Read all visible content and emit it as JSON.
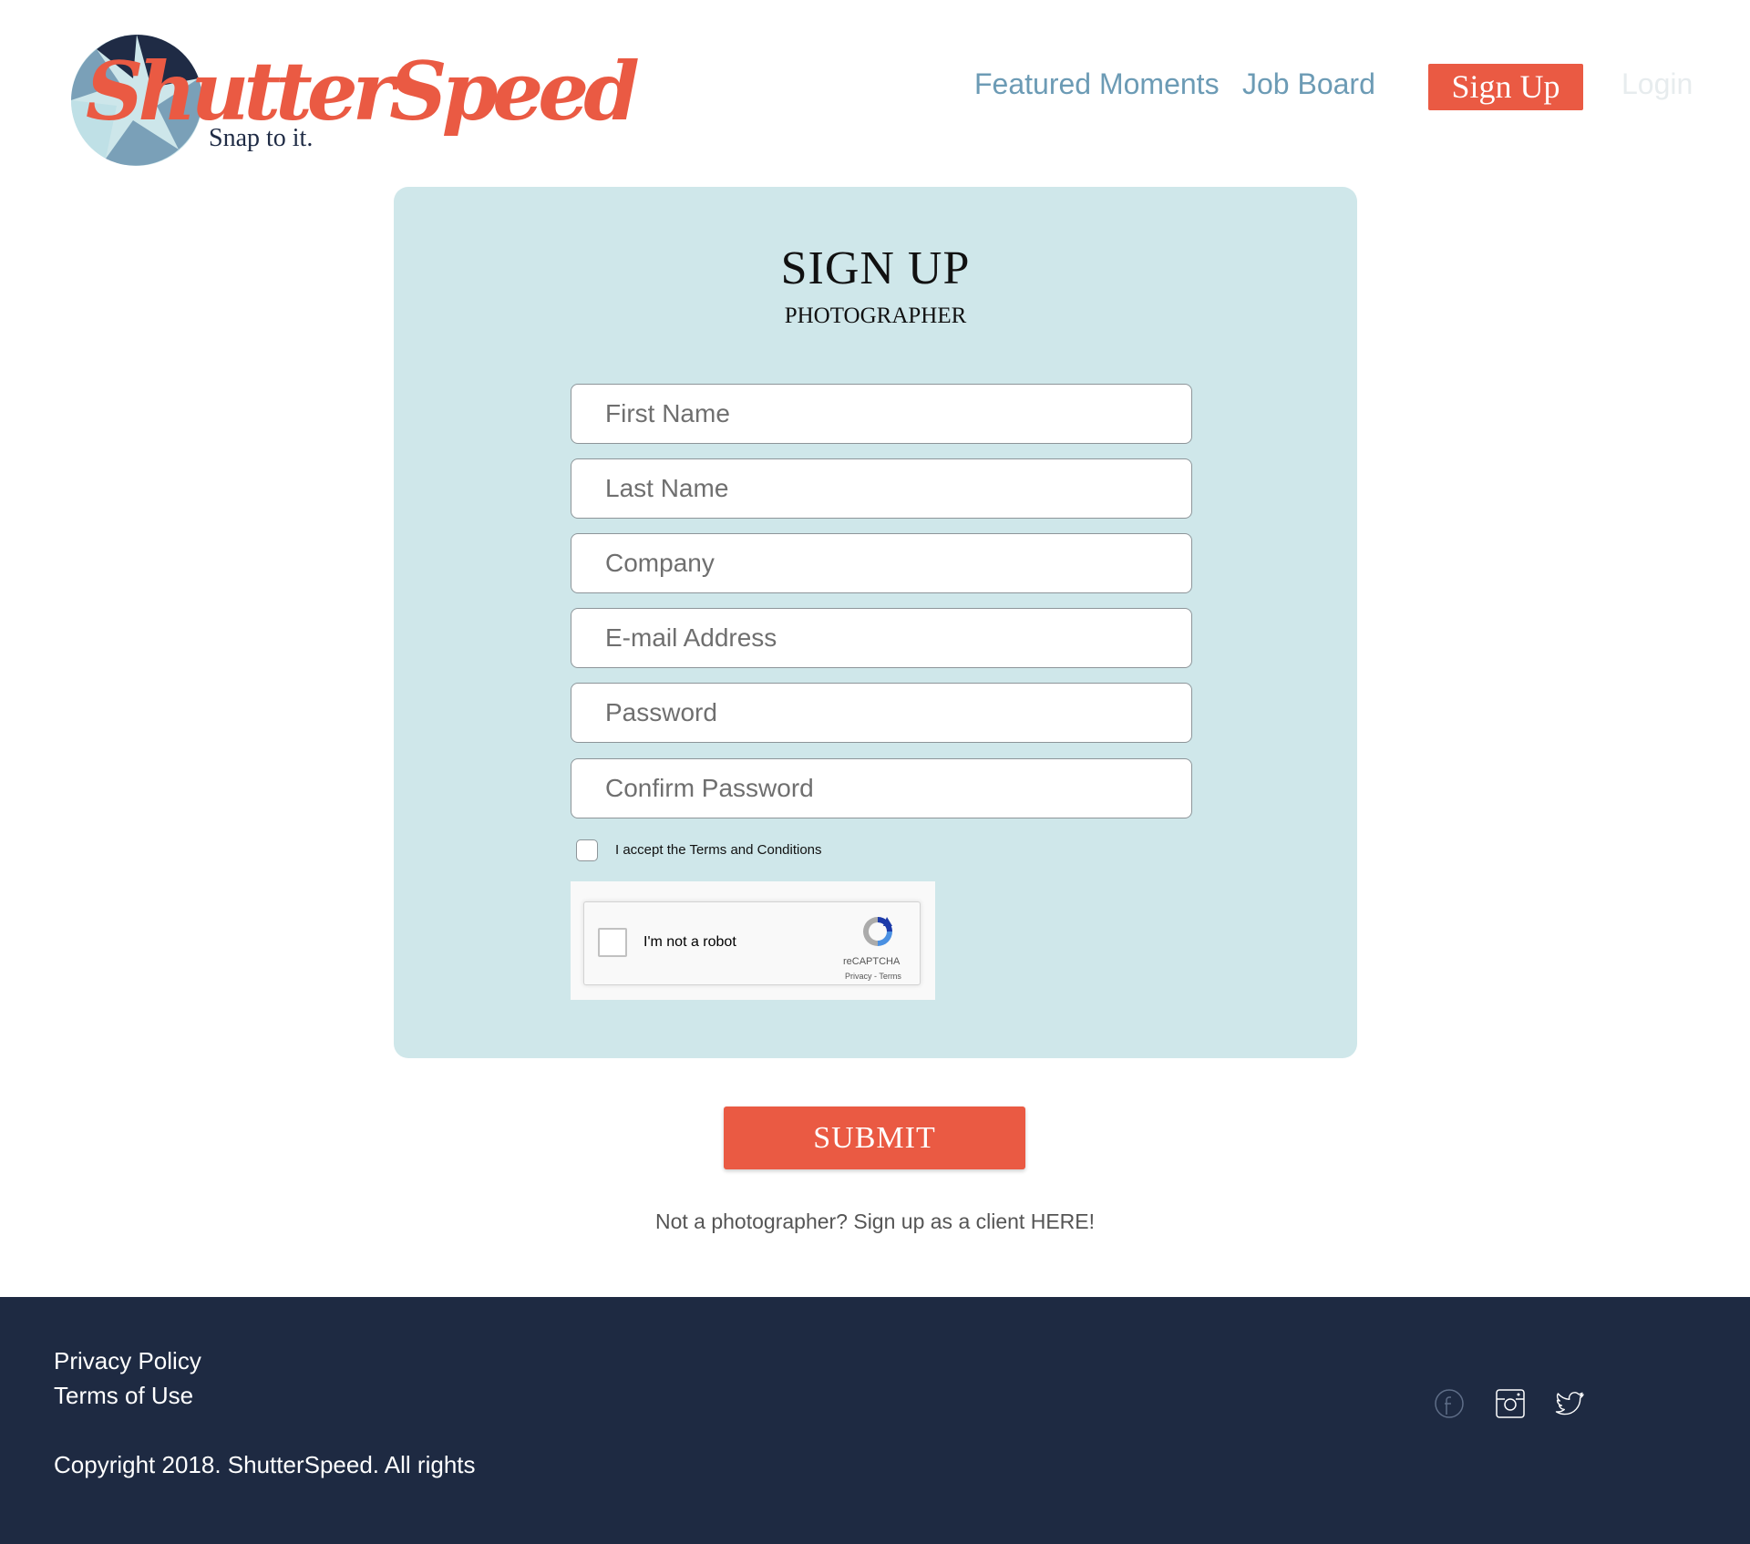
{
  "brand": {
    "name": "ShutterSpeed",
    "tagline": "Snap to it.",
    "colors": {
      "accent": "#ea5a43",
      "nav_link": "#6c9bb5",
      "card_bg": "#cfe7ea",
      "footer_bg": "#1e2a42"
    }
  },
  "nav": {
    "featured": "Featured Moments",
    "jobs": "Job Board",
    "signup": "Sign Up",
    "login": "Login"
  },
  "form": {
    "title": "SIGN UP",
    "subtitle": "PHOTOGRAPHER",
    "fields": {
      "first_name": "First Name",
      "last_name": "Last Name",
      "company": "Company",
      "email": "E-mail Address",
      "password": "Password",
      "confirm_password": "Confirm Password"
    },
    "terms_label": "I accept the Terms and Conditions",
    "captcha": {
      "label": "I'm not a robot",
      "brand": "reCAPTCHA",
      "links": "Privacy - Terms"
    },
    "submit": "SUBMIT",
    "client_link": "Not a photographer? Sign up as a client HERE!"
  },
  "footer": {
    "privacy": "Privacy Policy",
    "terms": "Terms of Use",
    "copyright": "Copyright 2018. ShutterSpeed. All rights",
    "social_icons": [
      "facebook-icon",
      "instagram-icon",
      "twitter-icon"
    ]
  }
}
